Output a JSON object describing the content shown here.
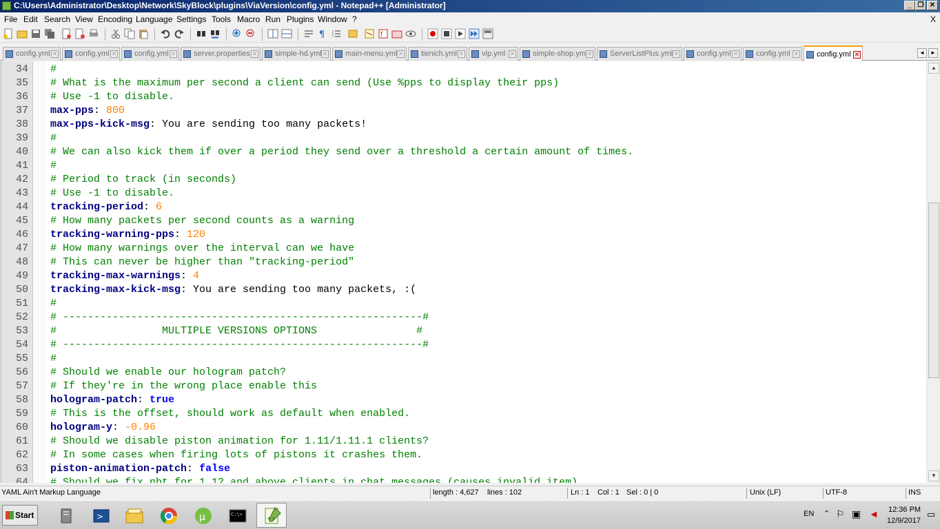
{
  "window": {
    "title": "C:\\Users\\Administrator\\Desktop\\Network\\SkyBlock\\plugins\\ViaVersion\\config.yml - Notepad++ [Administrator]",
    "controls": [
      "minimize",
      "restore",
      "close"
    ]
  },
  "menu": {
    "items": [
      "File",
      "Edit",
      "Search",
      "View",
      "Encoding",
      "Language",
      "Settings",
      "Tools",
      "Macro",
      "Run",
      "Plugins",
      "Window",
      "?"
    ],
    "close_doc": "X"
  },
  "toolbar": {
    "icons": [
      "new-file-icon",
      "open-file-icon",
      "save-icon",
      "save-all-icon",
      "close-icon",
      "close-all-icon",
      "print-icon",
      "cut-icon",
      "copy-icon",
      "paste-icon",
      "undo-icon",
      "redo-icon",
      "find-icon",
      "replace-icon",
      "zoom-in-icon",
      "zoom-out-icon",
      "sync-vertical-icon",
      "sync-horizontal-icon",
      "word-wrap-icon",
      "show-all-chars-icon",
      "indent-guide-icon",
      "user-language-icon",
      "doc-map-icon",
      "function-list-icon",
      "folder-workspace-icon",
      "monitoring-icon",
      "record-macro-icon",
      "stop-macro-icon",
      "play-macro-icon",
      "run-macro-multiple-icon",
      "save-macro-icon"
    ]
  },
  "tabs": [
    {
      "label": "config.yml",
      "active": false
    },
    {
      "label": "config.yml",
      "active": false
    },
    {
      "label": "config.yml",
      "active": false
    },
    {
      "label": "server.properties",
      "active": false
    },
    {
      "label": "simple-hd.yml",
      "active": false
    },
    {
      "label": "main-menu.yml",
      "active": false
    },
    {
      "label": "tienich.yml",
      "active": false
    },
    {
      "label": "vip.yml",
      "active": false
    },
    {
      "label": "simple-shop.yml",
      "active": false
    },
    {
      "label": "ServerListPlus.yml",
      "active": false
    },
    {
      "label": "config.yml",
      "active": false
    },
    {
      "label": "config.yml",
      "active": false
    },
    {
      "label": "config.yml",
      "active": true
    }
  ],
  "lines": [
    {
      "n": "34",
      "parts": [
        {
          "t": "#",
          "c": "cmt"
        }
      ]
    },
    {
      "n": "35",
      "parts": [
        {
          "t": "# What is the maximum per second a client can send (Use %pps to display their pps)",
          "c": "cmt"
        }
      ]
    },
    {
      "n": "36",
      "parts": [
        {
          "t": "# Use -1 to disable.",
          "c": "cmt"
        }
      ]
    },
    {
      "n": "37",
      "parts": [
        {
          "t": "max-pps",
          "c": "key"
        },
        {
          "t": ": ",
          "c": "txt"
        },
        {
          "t": "800",
          "c": "num"
        }
      ]
    },
    {
      "n": "38",
      "parts": [
        {
          "t": "max-pps-kick-msg",
          "c": "key"
        },
        {
          "t": ": You are sending too many packets!",
          "c": "txt"
        }
      ]
    },
    {
      "n": "39",
      "parts": [
        {
          "t": "#",
          "c": "cmt"
        }
      ]
    },
    {
      "n": "40",
      "parts": [
        {
          "t": "# We can also kick them if over a period they send over a threshold a certain amount of times.",
          "c": "cmt"
        }
      ]
    },
    {
      "n": "41",
      "parts": [
        {
          "t": "#",
          "c": "cmt"
        }
      ]
    },
    {
      "n": "42",
      "parts": [
        {
          "t": "# Period to track (in seconds)",
          "c": "cmt"
        }
      ]
    },
    {
      "n": "43",
      "parts": [
        {
          "t": "# Use -1 to disable.",
          "c": "cmt"
        }
      ]
    },
    {
      "n": "44",
      "parts": [
        {
          "t": "tracking-period",
          "c": "key"
        },
        {
          "t": ": ",
          "c": "txt"
        },
        {
          "t": "6",
          "c": "num"
        }
      ]
    },
    {
      "n": "45",
      "parts": [
        {
          "t": "# How many packets per second counts as a warning",
          "c": "cmt"
        }
      ]
    },
    {
      "n": "46",
      "parts": [
        {
          "t": "tracking-warning-pps",
          "c": "key"
        },
        {
          "t": ": ",
          "c": "txt"
        },
        {
          "t": "120",
          "c": "num"
        }
      ]
    },
    {
      "n": "47",
      "parts": [
        {
          "t": "# How many warnings over the interval can we have",
          "c": "cmt"
        }
      ]
    },
    {
      "n": "48",
      "parts": [
        {
          "t": "# This can never be higher than \"tracking-period\"",
          "c": "cmt"
        }
      ]
    },
    {
      "n": "49",
      "parts": [
        {
          "t": "tracking-max-warnings",
          "c": "key"
        },
        {
          "t": ": ",
          "c": "txt"
        },
        {
          "t": "4",
          "c": "num"
        }
      ]
    },
    {
      "n": "50",
      "parts": [
        {
          "t": "tracking-max-kick-msg",
          "c": "key"
        },
        {
          "t": ": You are sending too many packets, :(",
          "c": "txt"
        }
      ]
    },
    {
      "n": "51",
      "parts": [
        {
          "t": "#",
          "c": "cmt"
        }
      ]
    },
    {
      "n": "52",
      "parts": [
        {
          "t": "# ----------------------------------------------------------#",
          "c": "cmt"
        }
      ]
    },
    {
      "n": "53",
      "parts": [
        {
          "t": "#                 MULTIPLE VERSIONS OPTIONS                #",
          "c": "cmt"
        }
      ]
    },
    {
      "n": "54",
      "parts": [
        {
          "t": "# ----------------------------------------------------------#",
          "c": "cmt"
        }
      ]
    },
    {
      "n": "55",
      "parts": [
        {
          "t": "#",
          "c": "cmt"
        }
      ]
    },
    {
      "n": "56",
      "parts": [
        {
          "t": "# Should we enable our hologram patch?",
          "c": "cmt"
        }
      ]
    },
    {
      "n": "57",
      "parts": [
        {
          "t": "# If they're in the wrong place enable this",
          "c": "cmt"
        }
      ]
    },
    {
      "n": "58",
      "parts": [
        {
          "t": "hologram-patch",
          "c": "key"
        },
        {
          "t": ": ",
          "c": "txt"
        },
        {
          "t": "true",
          "c": "boolv"
        }
      ]
    },
    {
      "n": "59",
      "parts": [
        {
          "t": "# This is the offset, should work as default when enabled.",
          "c": "cmt"
        }
      ]
    },
    {
      "n": "60",
      "parts": [
        {
          "t": "hologram-y",
          "c": "key"
        },
        {
          "t": ": ",
          "c": "txt"
        },
        {
          "t": "-0.96",
          "c": "num"
        }
      ]
    },
    {
      "n": "61",
      "parts": [
        {
          "t": "# Should we disable piston animation for 1.11/1.11.1 clients?",
          "c": "cmt"
        }
      ]
    },
    {
      "n": "62",
      "parts": [
        {
          "t": "# In some cases when firing lots of pistons it crashes them.",
          "c": "cmt"
        }
      ]
    },
    {
      "n": "63",
      "parts": [
        {
          "t": "piston-animation-patch",
          "c": "key"
        },
        {
          "t": ": ",
          "c": "txt"
        },
        {
          "t": "false",
          "c": "boolv"
        }
      ]
    },
    {
      "n": "64",
      "parts": [
        {
          "t": "# Should we fix nbt for 1.12 and above clients in chat messages (causes invalid item)",
          "c": "cmt"
        }
      ]
    }
  ],
  "status": {
    "language": "YAML Ain't Markup Language",
    "length": "length : 4,627",
    "lines": "lines : 102",
    "ln": "Ln : 1",
    "col": "Col : 1",
    "sel": "Sel : 0 | 0",
    "eol": "Unix (LF)",
    "encoding": "UTF-8",
    "mode": "INS"
  },
  "taskbar": {
    "start_label": "Start",
    "apps": [
      "server-manager-icon",
      "powershell-icon",
      "explorer-icon",
      "chrome-icon",
      "utorrent-icon",
      "cmd-icon",
      "notepadpp-icon"
    ],
    "language": "EN",
    "time": "12:36 PM",
    "date": "12/9/2017"
  },
  "colors": {
    "comment": "#008000",
    "key": "#000080",
    "number": "#ff8000",
    "boolean": "#0000ff",
    "active_tab_accent": "#f6a000"
  }
}
